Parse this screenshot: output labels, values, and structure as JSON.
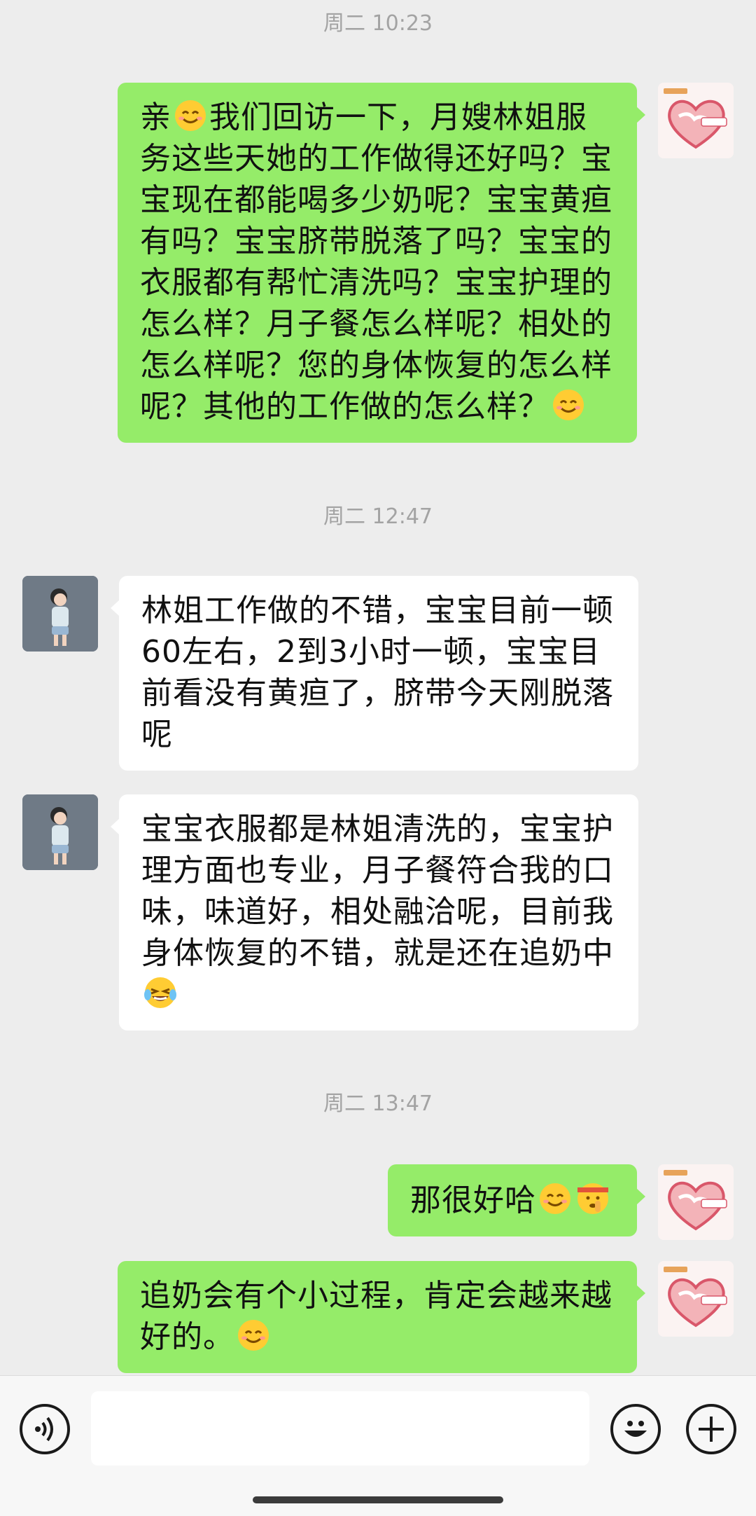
{
  "timestamps": [
    "周二 10:23",
    "周二 12:47",
    "周二 13:47"
  ],
  "messages": [
    {
      "sender": "agency",
      "text_before": "亲",
      "emoji_1": "smiling-face",
      "text_mid": "我们回访一下，月嫂林姐服务这些天她的工作做得还好吗？宝宝现在都能喝多少奶呢？宝宝黄疸有吗？宝宝脐带脱落了吗？宝宝的衣服都有帮忙清洗吗？宝宝护理的怎么样？月子餐怎么样呢？相处的怎么样呢？您的身体恢复的怎么样呢？其他的工作做的怎么样？",
      "emoji_2": "smiling-face"
    },
    {
      "sender": "customer",
      "text": "林姐工作做的不错，宝宝目前一顿60左右，2到3小时一顿，宝宝目前看没有黄疸了，脐带今天刚脱落呢"
    },
    {
      "sender": "customer",
      "text": "宝宝衣服都是林姐清洗的，宝宝护理方面也专业，月子餐符合我的口味，味道好，相处融洽呢，目前我身体恢复的不错，就是还在追奶中",
      "emoji": "laughing-tears"
    },
    {
      "sender": "agency",
      "text": "那很好哈",
      "emoji_1": "smiling-face",
      "emoji_2": "shushing-face"
    },
    {
      "sender": "agency",
      "text": "追奶会有个小过程，肯定会越来越好的。",
      "emoji": "smiling-face"
    }
  ],
  "input_bar": {
    "voice_icon": "voice-icon",
    "emoji_icon": "emoji-icon",
    "plus_icon": "plus-icon",
    "text_value": ""
  },
  "colors": {
    "background": "#ededed",
    "outgoing_bubble": "#95ec69",
    "incoming_bubble": "#ffffff",
    "timestamp": "#a3a3a3"
  }
}
